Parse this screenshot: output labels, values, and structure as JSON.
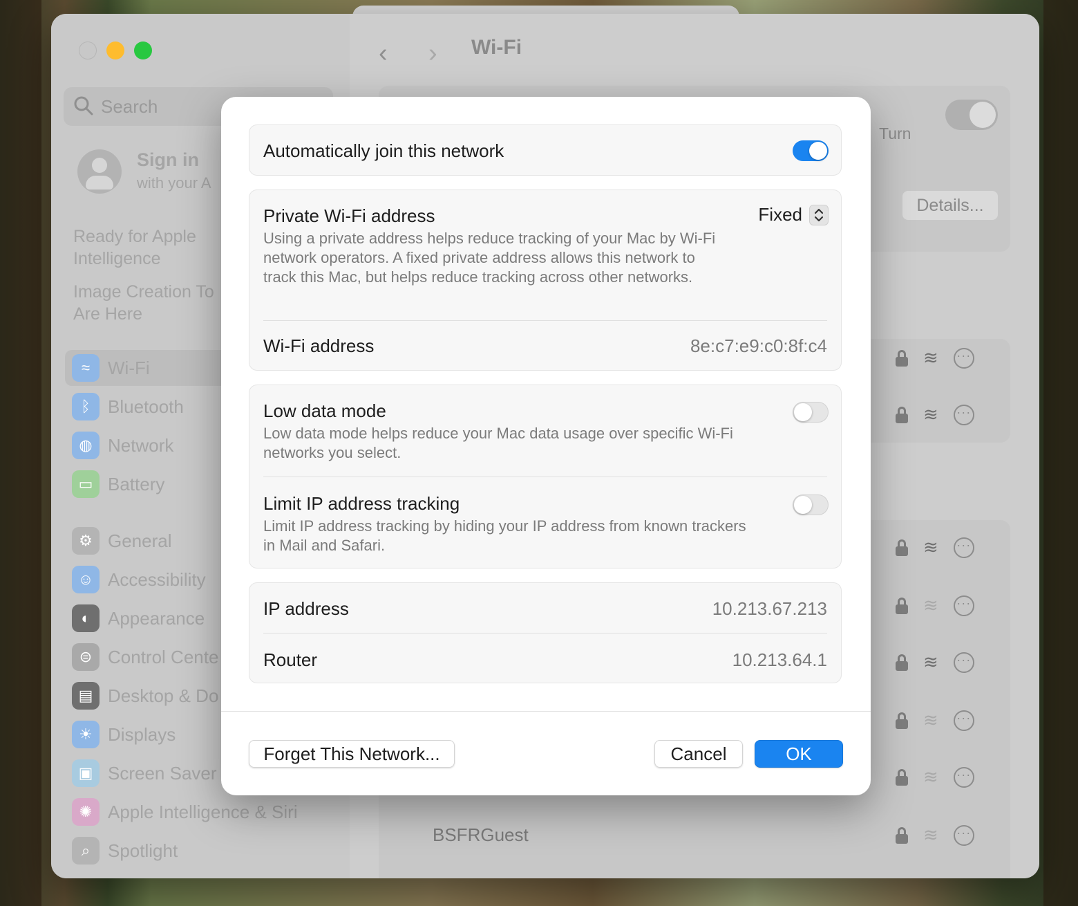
{
  "colors": {
    "accent": "#1a84f0",
    "close": "#c8c8c8",
    "minimize": "#febc2e",
    "zoom": "#28c840"
  },
  "sidebar": {
    "search_placeholder": "Search",
    "account_title": "Sign in",
    "account_subtitle": "with your A",
    "promo_1_line1": "Ready for Apple",
    "promo_1_line2": "Intelligence",
    "promo_2_line1": "Image Creation To",
    "promo_2_line2": "Are Here",
    "items": [
      {
        "label": "Wi-Fi",
        "icon": "wifi-icon"
      },
      {
        "label": "Bluetooth",
        "icon": "bluetooth-icon"
      },
      {
        "label": "Network",
        "icon": "globe-icon"
      },
      {
        "label": "Battery",
        "icon": "battery-icon"
      },
      {
        "label": "General",
        "icon": "gear-icon"
      },
      {
        "label": "Accessibility",
        "icon": "accessibility-icon"
      },
      {
        "label": "Appearance",
        "icon": "appearance-icon"
      },
      {
        "label": "Control Cente",
        "icon": "control-center-icon"
      },
      {
        "label": "Desktop & Do",
        "icon": "desktop-dock-icon"
      },
      {
        "label": "Displays",
        "icon": "displays-icon"
      },
      {
        "label": "Screen Saver",
        "icon": "screen-saver-icon"
      },
      {
        "label": "Apple Intelligence & Siri",
        "icon": "siri-icon"
      },
      {
        "label": "Spotlight",
        "icon": "spotlight-icon"
      }
    ]
  },
  "header": {
    "title": "Wi-Fi"
  },
  "background": {
    "turn_text": "Turn",
    "details_button": "Details...",
    "last_network": "BSFRGuest"
  },
  "dialog": {
    "auto_join": {
      "label": "Automatically join this network",
      "on": true
    },
    "private_address": {
      "label": "Private Wi-Fi address",
      "value": "Fixed",
      "description": "Using a private address helps reduce tracking of your Mac by Wi-Fi network operators. A fixed private address allows this network to track this Mac, but helps reduce tracking across other networks."
    },
    "wifi_address": {
      "label": "Wi-Fi address",
      "value": "8e:c7:e9:c0:8f:c4"
    },
    "low_data": {
      "label": "Low data mode",
      "on": false,
      "description": "Low data mode helps reduce your Mac data usage over specific Wi-Fi networks you select."
    },
    "limit_ip": {
      "label": "Limit IP address tracking",
      "on": false,
      "description": "Limit IP address tracking by hiding your IP address from known trackers in Mail and Safari."
    },
    "ip_address": {
      "label": "IP address",
      "value": "10.213.67.213"
    },
    "router": {
      "label": "Router",
      "value": "10.213.64.1"
    },
    "buttons": {
      "forget": "Forget This Network...",
      "cancel": "Cancel",
      "ok": "OK"
    }
  }
}
